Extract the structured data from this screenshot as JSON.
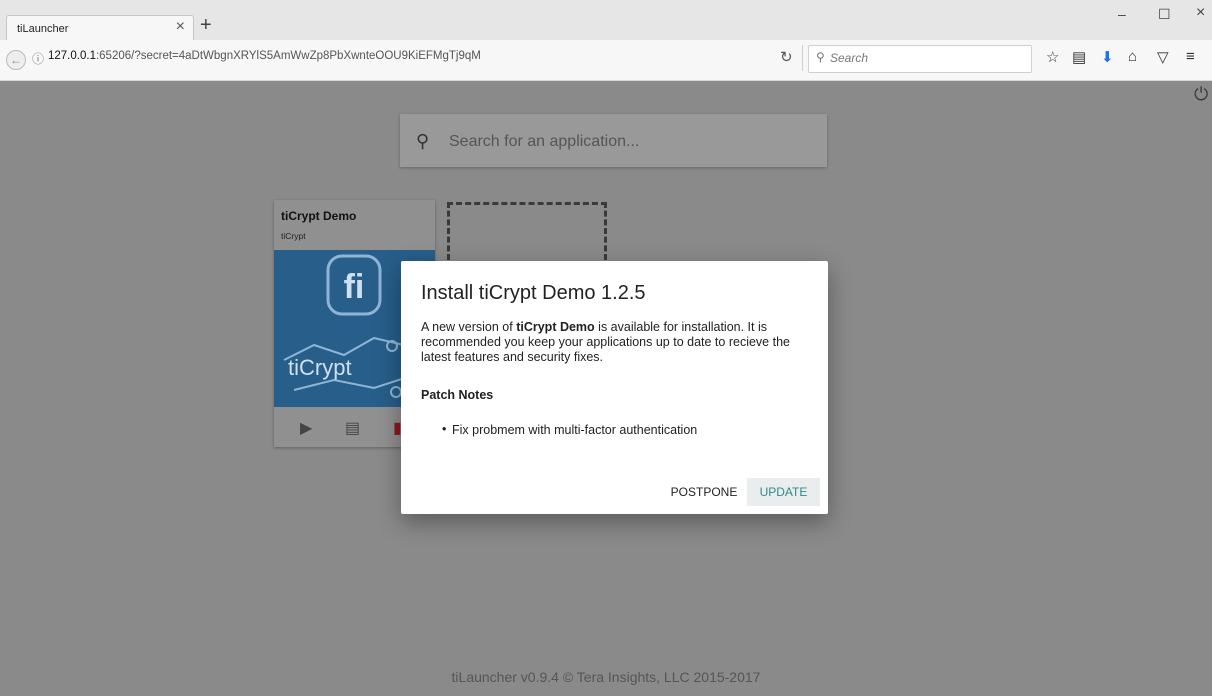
{
  "browser": {
    "tab_title": "tiLauncher",
    "tab_close": "×",
    "new_tab": "+",
    "window_buttons": [
      "–",
      "☐",
      "×"
    ],
    "url_host": "127.0.0.1",
    "url_rest": ":65206/?secret=4aDtWbgnXRYlS5AmWwZp8PbXwnteOOU9KiEFMgTj9qM",
    "search_placeholder": "Search"
  },
  "app": {
    "search_placeholder": "Search for an application...",
    "card": {
      "title": "tiCrypt Demo",
      "subtitle": "tiCrypt",
      "logo_text": "tiCrypt"
    },
    "footer": "tiLauncher v0.9.4 © Tera Insights, LLC 2015-2017"
  },
  "dialog": {
    "title": "Install tiCrypt Demo 1.2.5",
    "body_prefix": "A new version of ",
    "body_app": "tiCrypt Demo",
    "body_suffix": " is available for installation. It is recommended you keep your applications up to date to recieve the latest features and security fixes.",
    "patch_notes_heading": "Patch Notes",
    "patch_notes": [
      "Fix probmem with multi-factor authentication"
    ],
    "postpone_label": "POSTPONE",
    "update_label": "UPDATE"
  },
  "colors": {
    "overlay": "#8a8a8a",
    "accent": "#2d8a8a",
    "card_image": "#275e8a"
  }
}
